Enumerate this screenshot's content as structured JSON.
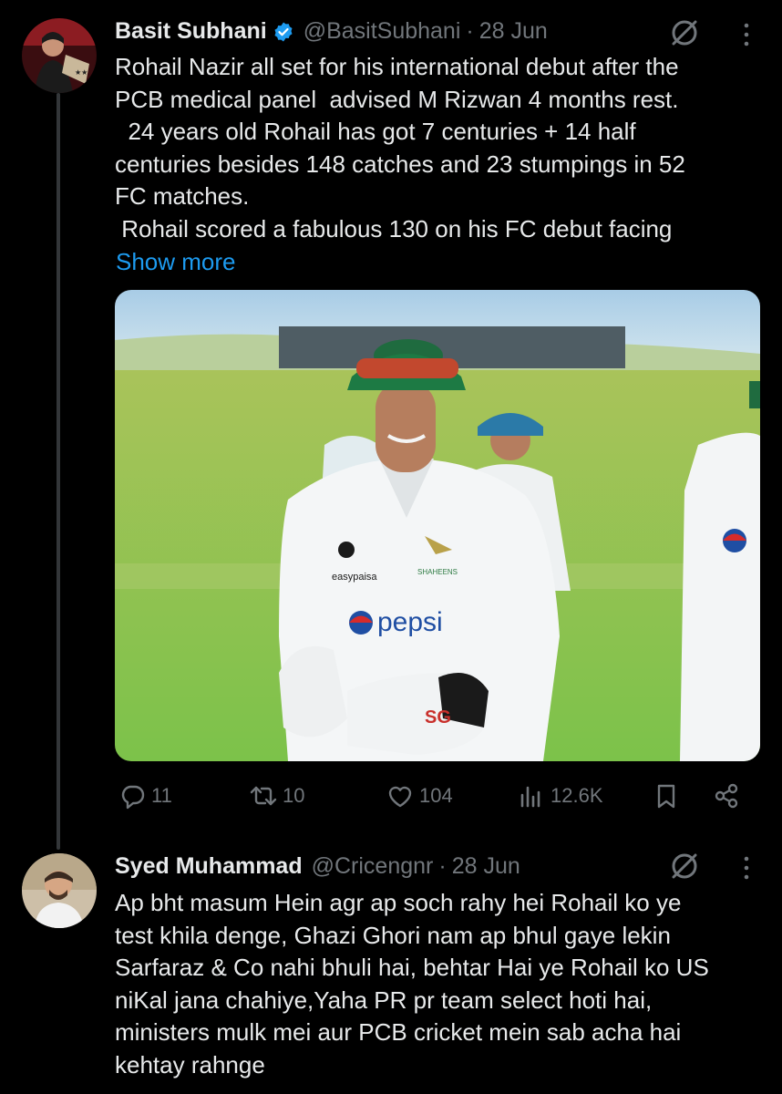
{
  "tweet": {
    "author_name": "Basit Subhani",
    "handle": "@BasitSubhani",
    "separator": "·",
    "date": "28 Jun",
    "text": "Rohail Nazir all set for his international debut after the\nPCB medical panel  advised M Rizwan 4 months rest.\n  24 years old Rohail has got 7 centuries + 14 half\ncenturies besides 148 catches and 23 stumpings in 52\nFC matches.\n Rohail scored a fabulous 130 on his FC debut facing",
    "show_more": "Show more",
    "image_alt": "Cricketer in white Pakistan test kit with wicketkeeping gloves, smiling on the field",
    "actions": {
      "replies": "11",
      "reposts": "10",
      "likes": "104",
      "views": "12.6K"
    }
  },
  "reply": {
    "author_name": "Syed Muhammad",
    "handle": "@Cricengnr",
    "separator": "·",
    "date": "28 Jun",
    "text": "Ap bht masum Hein agr ap soch rahy hei Rohail ko ye\ntest khila denge, Ghazi Ghori nam ap bhul gaye lekin\nSarfaraz & Co nahi bhuli hai, behtar Hai ye Rohail ko US\nniKal jana chahiye,Yaha PR pr team select hoti hai,\nministers mulk mei aur PCB cricket mein sab acha hai\nkehtay rahnge"
  },
  "colors": {
    "background": "#000000",
    "text": "#e7e9ea",
    "secondary": "#71767b",
    "link": "#1d9bf0",
    "verified": "#1d9bf0",
    "thread_line": "#333639"
  },
  "icons": [
    "verified-badge-icon",
    "grok-icon",
    "more-icon",
    "reply-icon",
    "repost-icon",
    "like-icon",
    "views-icon",
    "bookmark-icon",
    "share-icon"
  ]
}
